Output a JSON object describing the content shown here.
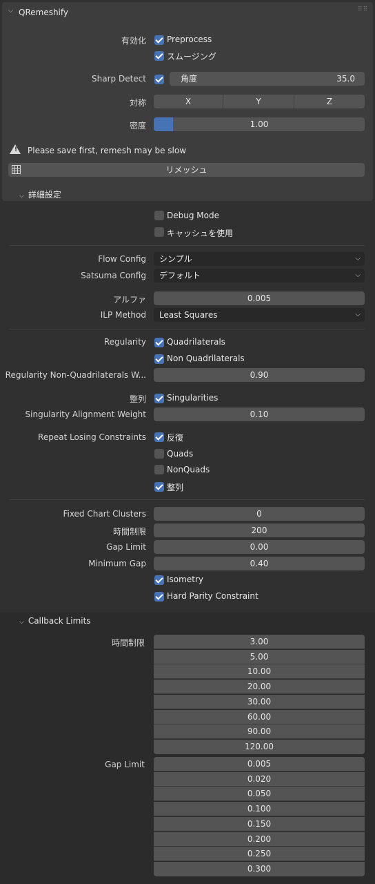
{
  "panel": {
    "title": "QRemeshify",
    "enable_label": "有効化",
    "preprocess_label": "Preprocess",
    "preprocess_checked": true,
    "smoothing_label": "スムージング",
    "smoothing_checked": true,
    "sharp_detect_label": "Sharp Detect",
    "sharp_detect_checked": true,
    "angle_label": "角度",
    "angle_value": "35.0",
    "symmetry_label": "対称",
    "sym_x": "X",
    "sym_y": "Y",
    "sym_z": "Z",
    "density_label": "密度",
    "density_value": "1.00",
    "density_fill_fraction": 0.09,
    "warning_text": "Please save first, remesh may be slow",
    "remesh_button": "リメッシュ"
  },
  "advanced": {
    "header": "詳細設定",
    "debug_mode_label": "Debug Mode",
    "debug_mode_checked": false,
    "use_cache_label": "キャッシュを使用",
    "use_cache_checked": false,
    "flow_config_label": "Flow Config",
    "flow_config_value": "シンプル",
    "satsuma_config_label": "Satsuma Config",
    "satsuma_config_value": "デフォルト",
    "alpha_label": "アルファ",
    "alpha_value": "0.005",
    "ilp_method_label": "ILP Method",
    "ilp_method_value": "Least Squares",
    "regularity_label": "Regularity",
    "quadrilaterals_label": "Quadrilaterals",
    "quadrilaterals_checked": true,
    "non_quadrilaterals_label": "Non Quadrilaterals",
    "non_quadrilaterals_checked": true,
    "reg_nonquad_weight_label": "Regularity Non-Quadrilaterals W...",
    "reg_nonquad_weight_value": "0.90",
    "alignment_label": "整列",
    "singularities_label": "Singularities",
    "singularities_checked": true,
    "singularity_weight_label": "Singularity Alignment Weight",
    "singularity_weight_value": "0.10",
    "repeat_losing_label": "Repeat Losing Constraints",
    "repeat_label": "反復",
    "repeat_checked": true,
    "quads_label": "Quads",
    "quads_checked": false,
    "nonquads_label": "NonQuads",
    "nonquads_checked": false,
    "align_label": "整列",
    "align_checked": true,
    "fixed_chart_label": "Fixed Chart Clusters",
    "fixed_chart_value": "0",
    "time_limit_label": "時間制限",
    "time_limit_value": "200",
    "gap_limit_label": "Gap Limit",
    "gap_limit_value": "0.00",
    "minimum_gap_label": "Minimum Gap",
    "minimum_gap_value": "0.40",
    "isometry_label": "Isometry",
    "isometry_checked": true,
    "hard_parity_label": "Hard Parity Constraint",
    "hard_parity_checked": true
  },
  "callback": {
    "header": "Callback Limits",
    "time_limit_label": "時間制限",
    "time_limits": [
      "3.00",
      "5.00",
      "10.00",
      "20.00",
      "30.00",
      "60.00",
      "90.00",
      "120.00"
    ],
    "gap_limit_label": "Gap Limit",
    "gap_limits": [
      "0.005",
      "0.020",
      "0.050",
      "0.100",
      "0.150",
      "0.200",
      "0.250",
      "0.300"
    ]
  },
  "colors": {
    "accent": "#4772b3",
    "background": "#303030",
    "panel": "#3d3d3d",
    "field": "#545454",
    "dropdown": "#282828"
  }
}
